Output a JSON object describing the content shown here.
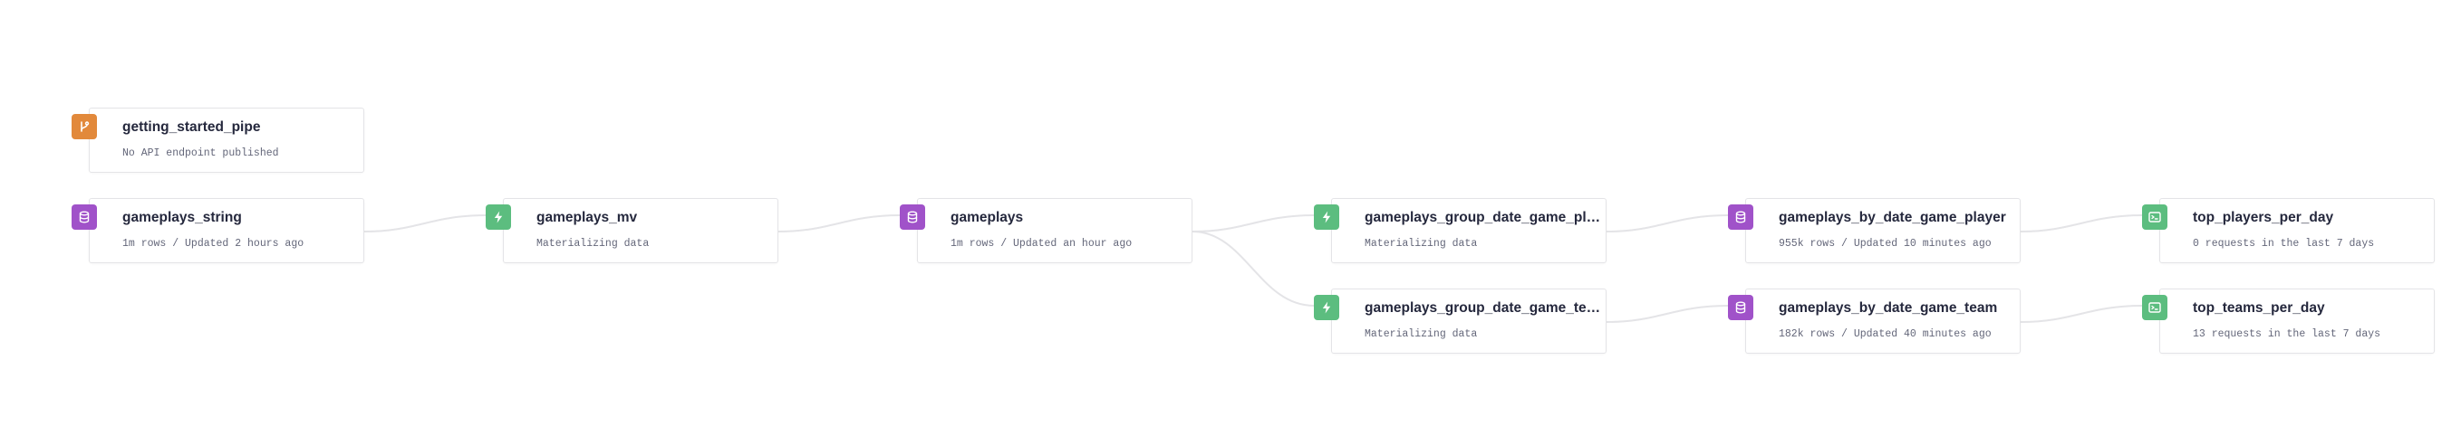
{
  "colors": {
    "pipe_badge": "#e2893b",
    "datasource_badge": "#a052c9",
    "materialized_badge": "#5cbd7f",
    "endpoint_badge": "#5cbd7f",
    "edge": "#e4e4e7",
    "card_border": "#e4e4e7",
    "title_text": "#25283d",
    "subtitle_text": "#636679"
  },
  "nodes": {
    "getting_started_pipe": {
      "icon": "pipe-branch-icon",
      "title": "getting_started_pipe",
      "subtitle": "No API endpoint published"
    },
    "gameplays_string": {
      "icon": "datasource-database-icon",
      "title": "gameplays_string",
      "subtitle": "1m rows / Updated 2 hours ago"
    },
    "gameplays_mv": {
      "icon": "materialized-lightning-icon",
      "title": "gameplays_mv",
      "subtitle": "Materializing data"
    },
    "gameplays": {
      "icon": "datasource-database-icon",
      "title": "gameplays",
      "subtitle": "1m rows / Updated an hour ago"
    },
    "gameplays_group_date_game_player": {
      "icon": "materialized-lightning-icon",
      "title": "gameplays_group_date_game_player...",
      "subtitle": "Materializing data"
    },
    "gameplays_group_date_game_team": {
      "icon": "materialized-lightning-icon",
      "title": "gameplays_group_date_game_team_m...",
      "subtitle": "Materializing data"
    },
    "gameplays_by_date_game_player": {
      "icon": "datasource-database-icon",
      "title": "gameplays_by_date_game_player",
      "subtitle": "955k rows / Updated 10 minutes ago"
    },
    "gameplays_by_date_game_team": {
      "icon": "datasource-database-icon",
      "title": "gameplays_by_date_game_team",
      "subtitle": "182k rows / Updated 40 minutes ago"
    },
    "top_players_per_day": {
      "icon": "endpoint-terminal-icon",
      "title": "top_players_per_day",
      "subtitle": "0 requests in the last 7 days"
    },
    "top_teams_per_day": {
      "icon": "endpoint-terminal-icon",
      "title": "top_teams_per_day",
      "subtitle": "13 requests in the last 7 days"
    }
  }
}
